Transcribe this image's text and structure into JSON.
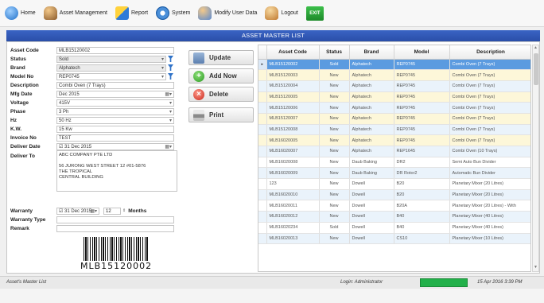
{
  "toolbar": {
    "items": [
      {
        "label": "Home",
        "icon": "home-icon"
      },
      {
        "label": "Asset Management",
        "icon": "asset-icon"
      },
      {
        "label": "Report",
        "icon": "report-icon"
      },
      {
        "label": "System",
        "icon": "system-icon"
      },
      {
        "label": "Modify User Data",
        "icon": "user-icon"
      },
      {
        "label": "Logout",
        "icon": "logout-icon"
      }
    ],
    "exit_label": "EXIT"
  },
  "title": "ASSET MASTER LIST",
  "form": {
    "asset_code": {
      "label": "Asset Code",
      "value": "MLB15120002"
    },
    "status": {
      "label": "Status",
      "value": "Sold"
    },
    "brand": {
      "label": "Brand",
      "value": "Alphatech"
    },
    "model_no": {
      "label": "Model No",
      "value": "REP0745"
    },
    "description": {
      "label": "Description",
      "value": "Combi Oven (7 Trays)"
    },
    "mfg_date": {
      "label": "Mfg Date",
      "value": "Dec 2015"
    },
    "voltage": {
      "label": "Voltage",
      "value": "415V"
    },
    "phase": {
      "label": "Phase",
      "value": "3 Ph"
    },
    "hz": {
      "label": "Hz",
      "value": "50 Hz"
    },
    "kw": {
      "label": "K.W.",
      "value": "15 Kw"
    },
    "invoice_no": {
      "label": "Invoice No",
      "value": "TEST"
    },
    "deliver_date": {
      "label": "Deliver Date",
      "value": "31 Dec 2015"
    },
    "deliver_to": {
      "label": "Deliver To",
      "line1": "ABC COMPANY PTE LTD",
      "line2": "56 JURONG WEST STREET 12 #01-5876",
      "line3": "THE TROPICAL",
      "line4": "CENTRAL BUILDING"
    },
    "warranty": {
      "label": "Warranty",
      "date": "31 Dec 2015",
      "count": "12",
      "unit": "Months"
    },
    "warranty_type": {
      "label": "Warranty Type",
      "value": ""
    },
    "remark": {
      "label": "Remark",
      "value": ""
    },
    "barcode_text": "MLB15120002"
  },
  "buttons": {
    "update": "Update",
    "add_new": "Add Now",
    "delete": "Delete",
    "print": "Print"
  },
  "grid": {
    "columns": [
      "Asset Code",
      "Status",
      "Brand",
      "Model",
      "Description"
    ],
    "rows": [
      {
        "code": "MLB15120002",
        "status": "Sold",
        "brand": "Alphatech",
        "model": "REP0745",
        "desc": "Combi Oven (7 Trays)"
      },
      {
        "code": "MLB15120003",
        "status": "New",
        "brand": "Alphatech",
        "model": "REP0745",
        "desc": "Combi Oven (7 Trays)"
      },
      {
        "code": "MLB15120004",
        "status": "New",
        "brand": "Alphatech",
        "model": "REP0745",
        "desc": "Combi Oven (7 Trays)"
      },
      {
        "code": "MLB15120005",
        "status": "New",
        "brand": "Alphatech",
        "model": "REP0745",
        "desc": "Combi Oven (7 Trays)"
      },
      {
        "code": "MLB15120006",
        "status": "New",
        "brand": "Alphatech",
        "model": "REP0745",
        "desc": "Combi Oven (7 Trays)"
      },
      {
        "code": "MLB15120007",
        "status": "New",
        "brand": "Alphatech",
        "model": "REP0745",
        "desc": "Combi Oven (7 Trays)"
      },
      {
        "code": "MLB15120008",
        "status": "New",
        "brand": "Alphatech",
        "model": "REP0745",
        "desc": "Combi Oven (7 Trays)"
      },
      {
        "code": "MLB16020005",
        "status": "New",
        "brand": "Alphatech",
        "model": "REP0745",
        "desc": "Combi Oven (7 Trays)"
      },
      {
        "code": "MLB16020007",
        "status": "New",
        "brand": "Alphatech",
        "model": "REP1645",
        "desc": "Combi Oven (10 Trays)"
      },
      {
        "code": "MLB16020008",
        "status": "New",
        "brand": "Daub Baking",
        "model": "DR2",
        "desc": "Semi Auto Bun Divider"
      },
      {
        "code": "MLB16020009",
        "status": "New",
        "brand": "Daub Baking",
        "model": "DR Rotor2",
        "desc": "Automatic Bun Divider"
      },
      {
        "code": "123",
        "status": "New",
        "brand": "Dowell",
        "model": "B20",
        "desc": "Planetary Mixer (20 Litres)"
      },
      {
        "code": "MLB16020010",
        "status": "New",
        "brand": "Dowell",
        "model": "B20",
        "desc": "Planetary Mixer (20 Litres)"
      },
      {
        "code": "MLB16020011",
        "status": "New",
        "brand": "Dowell",
        "model": "B20A",
        "desc": "Planetary Mixer (20 Litres) - With"
      },
      {
        "code": "MLB16020012",
        "status": "New",
        "brand": "Dowell",
        "model": "B40",
        "desc": "Planetary Mixer (40 Litres)"
      },
      {
        "code": "MLB16020234",
        "status": "Sold",
        "brand": "Dowell",
        "model": "B40",
        "desc": "Planetary Mixer (40 Litres)"
      },
      {
        "code": "MLB16020013",
        "status": "New",
        "brand": "Dowell",
        "model": "CS10",
        "desc": "Planetary Mixer (10 Litres)"
      }
    ]
  },
  "statusbar": {
    "form_name": "Asset's Master List",
    "login": "Login: Administrator",
    "datetime": "15 Apr 2016 3:39 PM"
  },
  "colors": {
    "title_bar": "#2a4ea8",
    "selected_row": "#5b9be0",
    "status_green": "#22b04a"
  }
}
